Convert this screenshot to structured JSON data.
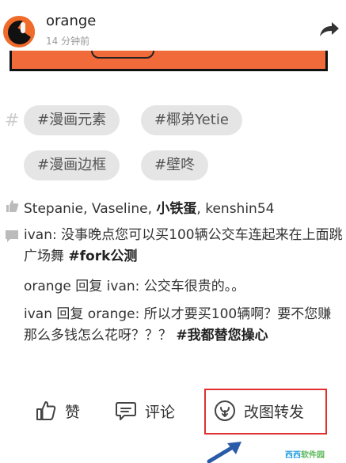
{
  "post": {
    "username": "orange",
    "time": "14 分钟前"
  },
  "tags": [
    "#漫画元素",
    "#椰弟Yetie",
    "#漫画边框",
    "#壁咚"
  ],
  "likes": {
    "part1": "Stepanie, Vaseline, ",
    "part2": "小铁蛋",
    "part3": ", kenshin54"
  },
  "comments": [
    {
      "author": "ivan",
      "sep": ": ",
      "text1": "没事晚点您可以买100辆公交车连起来在上面跳广场舞 ",
      "tag": "#fork公测"
    },
    {
      "author": "orange",
      "reply": " 回复 ",
      "target": "ivan",
      "sep": ": ",
      "text1": "公交车很贵的。。"
    },
    {
      "author": "ivan",
      "reply": " 回复 ",
      "target": "orange",
      "sep": ": ",
      "text1": "所以才要买100辆啊？要不您赚那么多钱怎么花呀？？？ ",
      "tag": "#我都替您操心"
    }
  ],
  "actions": {
    "like": "赞",
    "comment": "评论",
    "remix": "改图转发"
  },
  "watermark": {
    "part1": "西西",
    "part2": "软件园"
  },
  "colors": {
    "highlight": "#e03030",
    "arrow": "#2a5ba8",
    "tag_bg": "#e5e5e5",
    "avatar": "#f06a2a"
  },
  "icons": [
    "share-icon",
    "hash-icon",
    "thumbs-up-icon",
    "comment-bubble-icon",
    "smiley-bubble-icon",
    "remix-icon"
  ]
}
